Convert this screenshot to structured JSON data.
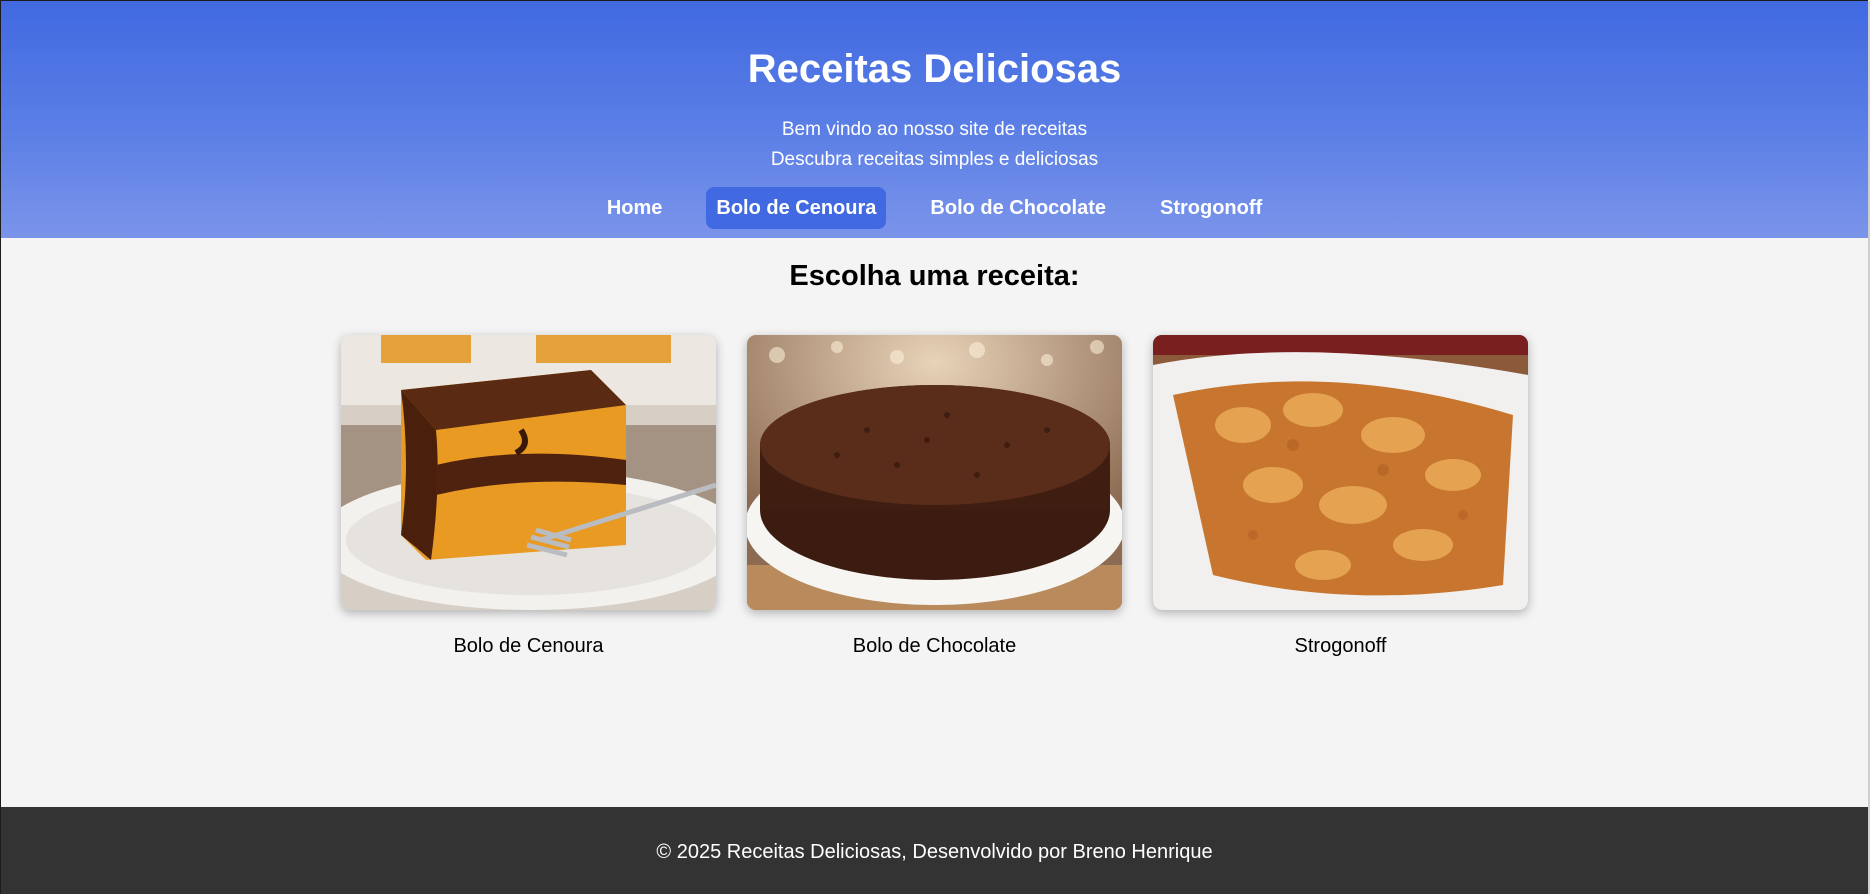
{
  "header": {
    "title": "Receitas Deliciosas",
    "subtitle_1": "Bem vindo ao nosso site de receitas",
    "subtitle_2": "Descubra receitas simples e deliciosas"
  },
  "nav": {
    "items": [
      {
        "label": "Home",
        "active": false
      },
      {
        "label": "Bolo de Cenoura",
        "active": true
      },
      {
        "label": "Bolo de Chocolate",
        "active": false
      },
      {
        "label": "Strogonoff",
        "active": false
      }
    ]
  },
  "main": {
    "heading": "Escolha uma receita:",
    "cards": [
      {
        "label": "Bolo de Cenoura",
        "image": "carrot-cake-photo"
      },
      {
        "label": "Bolo de Chocolate",
        "image": "chocolate-cake-photo"
      },
      {
        "label": "Strogonoff",
        "image": "strogonoff-photo"
      }
    ]
  },
  "footer": {
    "text": "© 2025 Receitas Deliciosas, Desenvolvido por Breno Henrique"
  },
  "colors": {
    "header_top": "#4169e1",
    "header_bottom": "#7b94ea",
    "nav_active": "#4169e1",
    "page_background": "#f4f4f4",
    "footer_background": "#333333"
  }
}
